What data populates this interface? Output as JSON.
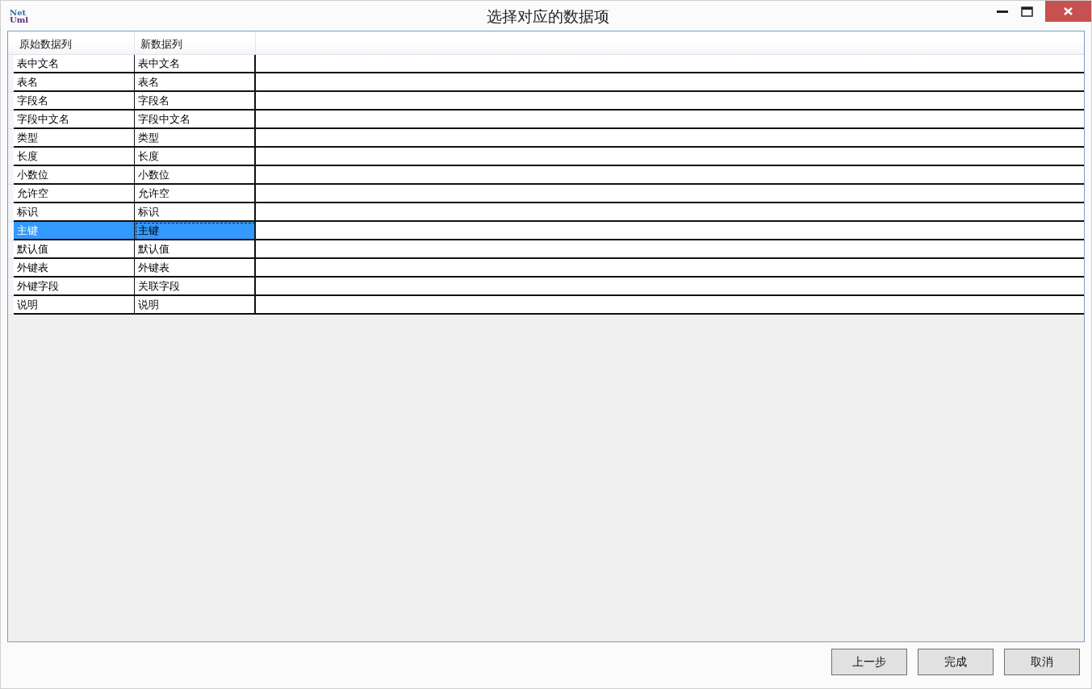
{
  "window": {
    "title": "选择对应的数据项",
    "logo": [
      "Net",
      "Uml"
    ]
  },
  "table": {
    "columns": [
      "原始数据列",
      "新数据列"
    ],
    "rows": [
      {
        "cells": [
          "表中文名",
          "表中文名"
        ],
        "selected": false
      },
      {
        "cells": [
          "表名",
          "表名"
        ],
        "selected": false
      },
      {
        "cells": [
          "字段名",
          "字段名"
        ],
        "selected": false
      },
      {
        "cells": [
          "字段中文名",
          "字段中文名"
        ],
        "selected": false
      },
      {
        "cells": [
          "类型",
          "类型"
        ],
        "selected": false
      },
      {
        "cells": [
          "长度",
          "长度"
        ],
        "selected": false
      },
      {
        "cells": [
          "小数位",
          "小数位"
        ],
        "selected": false
      },
      {
        "cells": [
          "允许空",
          "允许空"
        ],
        "selected": false
      },
      {
        "cells": [
          "标识",
          "标识"
        ],
        "selected": false
      },
      {
        "cells": [
          "主键",
          "主键"
        ],
        "selected": true
      },
      {
        "cells": [
          "默认值",
          "默认值"
        ],
        "selected": false
      },
      {
        "cells": [
          "外键表",
          "外键表"
        ],
        "selected": false
      },
      {
        "cells": [
          "外键字段",
          "关联字段"
        ],
        "selected": false
      },
      {
        "cells": [
          "说明",
          "说明"
        ],
        "selected": false
      }
    ]
  },
  "buttons": [
    "上一步",
    "完成",
    "取消"
  ]
}
